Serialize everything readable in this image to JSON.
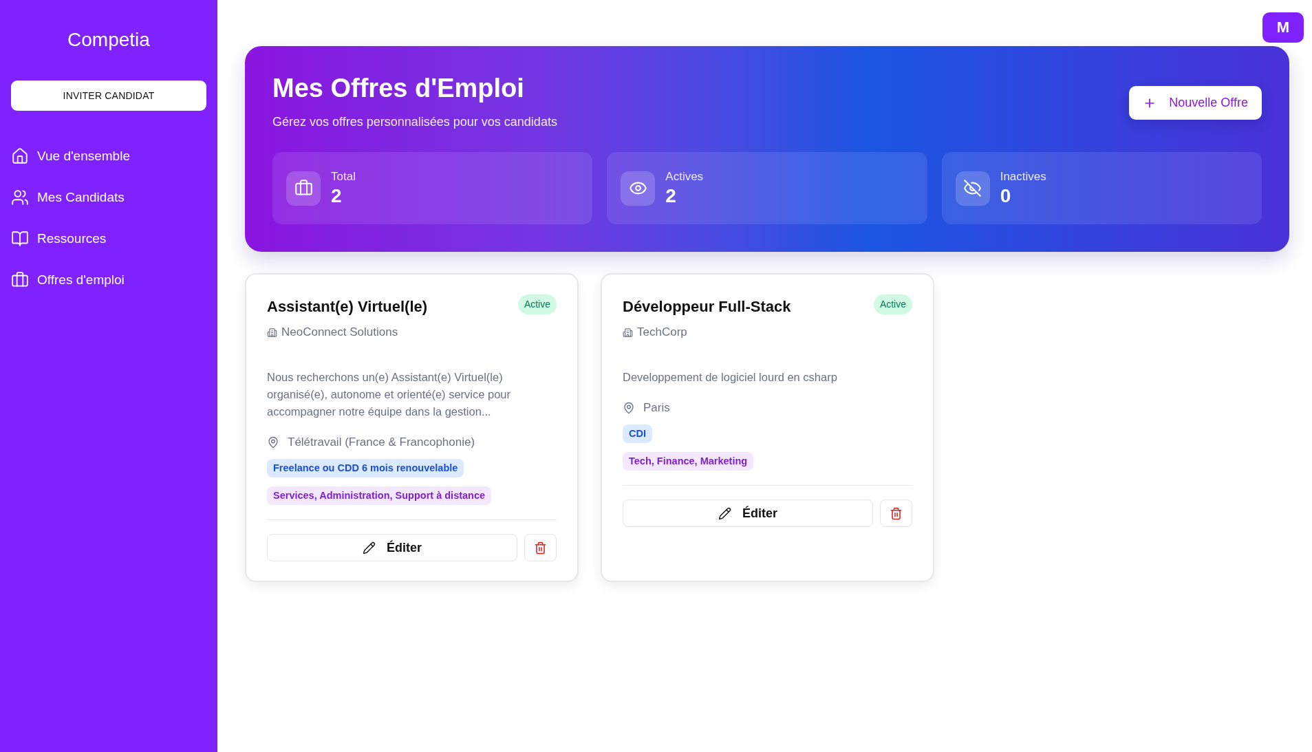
{
  "sidebar": {
    "logo": "Competia",
    "invite_button": "INVITER CANDIDAT",
    "items": [
      {
        "label": "Vue d'ensemble"
      },
      {
        "label": "Mes Candidats"
      },
      {
        "label": "Ressources"
      },
      {
        "label": "Offres d'emploi"
      }
    ]
  },
  "user_avatar": "M",
  "header": {
    "title": "Mes Offres d'Emploi",
    "subtitle": "Gérez vos offres personnalisées pour vos candidats",
    "new_button": "Nouvelle Offre",
    "stats": [
      {
        "label": "Total",
        "value": "2"
      },
      {
        "label": "Actives",
        "value": "2"
      },
      {
        "label": "Inactives",
        "value": "0"
      }
    ]
  },
  "offers": [
    {
      "title": "Assistant(e) Virtuel(le)",
      "status": "Active",
      "active": true,
      "company": "NeoConnect Solutions",
      "description": "Nous recherchons un(e) Assistant(e) Virtuel(le) organisé(e), autonome et orienté(e) service pour accompagner notre équipe dans la gestion...",
      "location": "Télétravail (France & Francophonie)",
      "tags": [
        {
          "kind": "contract",
          "label": "Freelance ou CDD 6 mois renouvelable"
        },
        {
          "kind": "sectors",
          "label": "Services, Administration, Support à distance"
        }
      ],
      "edit_button": "Éditer"
    },
    {
      "title": "Développeur Full-Stack",
      "status": "Active",
      "active": true,
      "company": "TechCorp",
      "description": "Developpement de logiciel lourd en csharp",
      "location": "Paris",
      "tags": [
        {
          "kind": "contract",
          "label": "CDI"
        },
        {
          "kind": "sectors",
          "label": "Tech, Finance, Marketing"
        }
      ],
      "edit_button": "Éditer"
    }
  ]
}
